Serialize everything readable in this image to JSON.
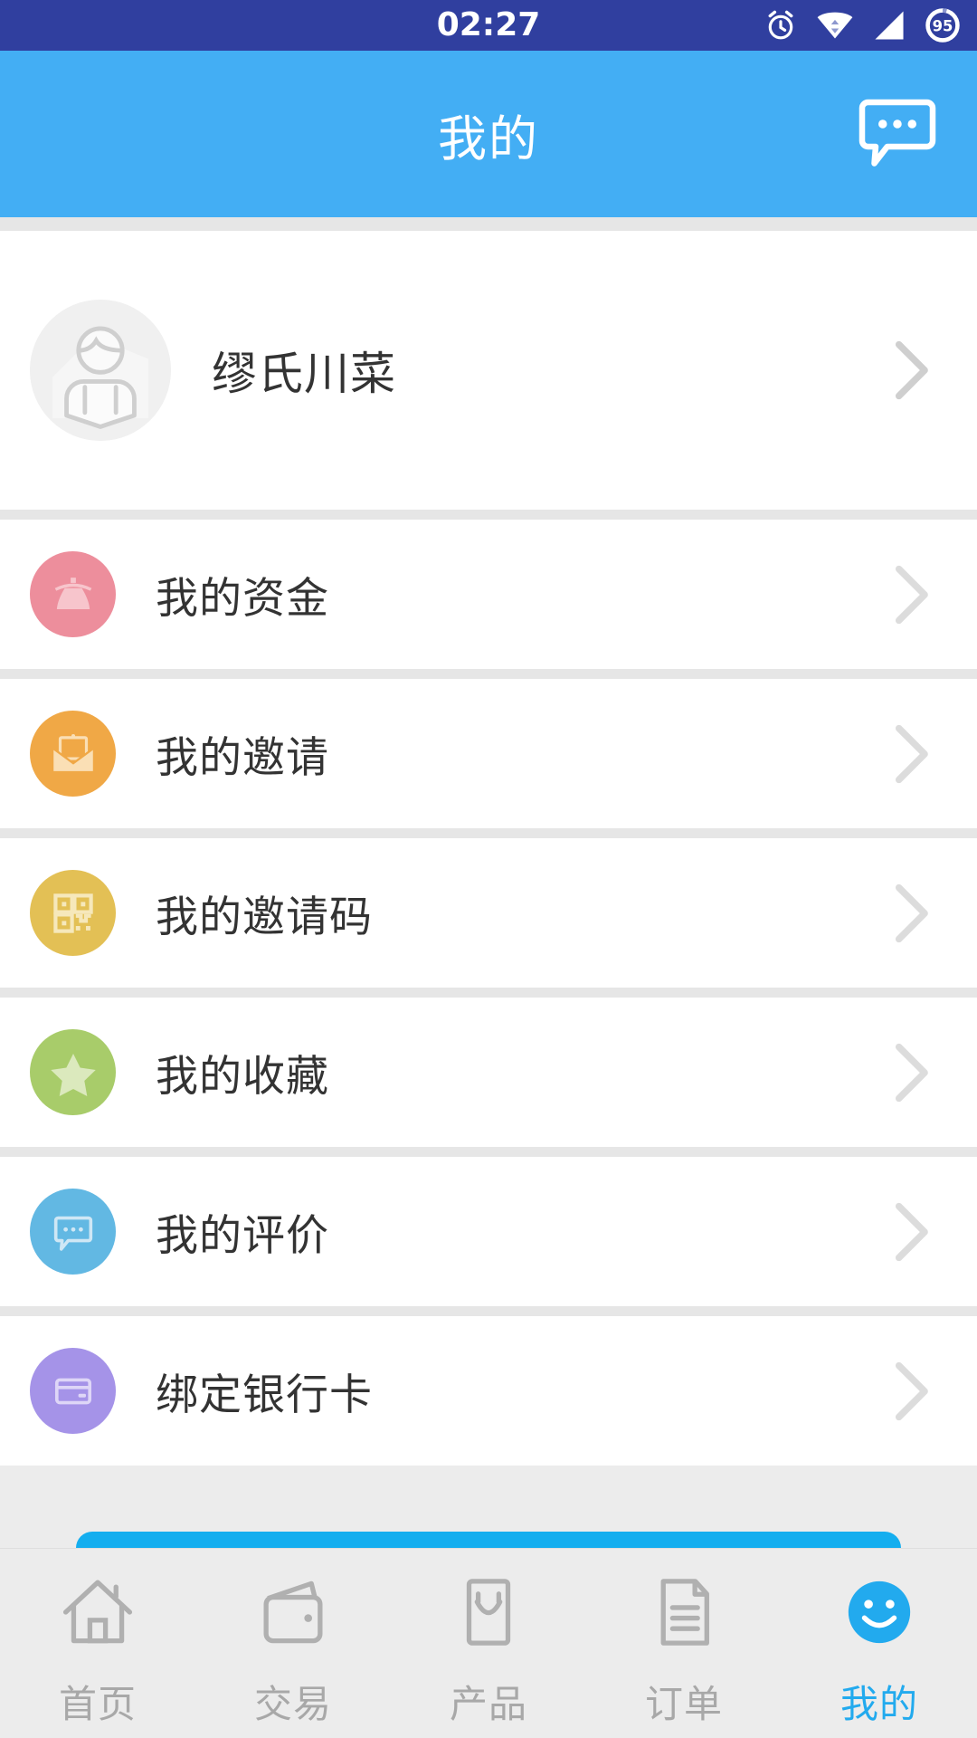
{
  "statusbar": {
    "time": "02:27",
    "battery_level": "95",
    "icons": [
      "alarm-clock-icon",
      "wifi-icon",
      "signal-icon",
      "battery-icon"
    ]
  },
  "header": {
    "title": "我的",
    "action_icon": "message-bubble-icon",
    "background": "#43AEF4"
  },
  "profile": {
    "name": "缪氏川菜",
    "avatar_icon": "default-user-avatar-icon",
    "chevron_icon": "chevron-right-icon"
  },
  "menu": {
    "items": [
      {
        "label": "我的资金",
        "icon": "wallet-purse-icon",
        "color": "#ED8E9C"
      },
      {
        "label": "我的邀请",
        "icon": "envelope-icon",
        "color": "#F0A846"
      },
      {
        "label": "我的邀请码",
        "icon": "qr-code-icon",
        "color": "#E3C055"
      },
      {
        "label": "我的收藏",
        "icon": "star-icon",
        "color": "#A8CC6A"
      },
      {
        "label": "我的评价",
        "icon": "chat-bubble-icon",
        "color": "#62B8E3"
      },
      {
        "label": "绑定银行卡",
        "icon": "credit-card-icon",
        "color": "#A593E8"
      }
    ]
  },
  "floating_button": {
    "color": "#14AEEF",
    "label": ""
  },
  "bottomnav": {
    "active_color": "#22AAEE",
    "inactive_color": "#a8a8a8",
    "items": [
      {
        "label": "首页",
        "icon": "home-icon",
        "active": false
      },
      {
        "label": "交易",
        "icon": "wallet-icon",
        "active": false
      },
      {
        "label": "产品",
        "icon": "bag-smile-icon",
        "active": false
      },
      {
        "label": "订单",
        "icon": "document-icon",
        "active": false
      },
      {
        "label": "我的",
        "icon": "smiley-face-icon",
        "active": true
      }
    ]
  }
}
